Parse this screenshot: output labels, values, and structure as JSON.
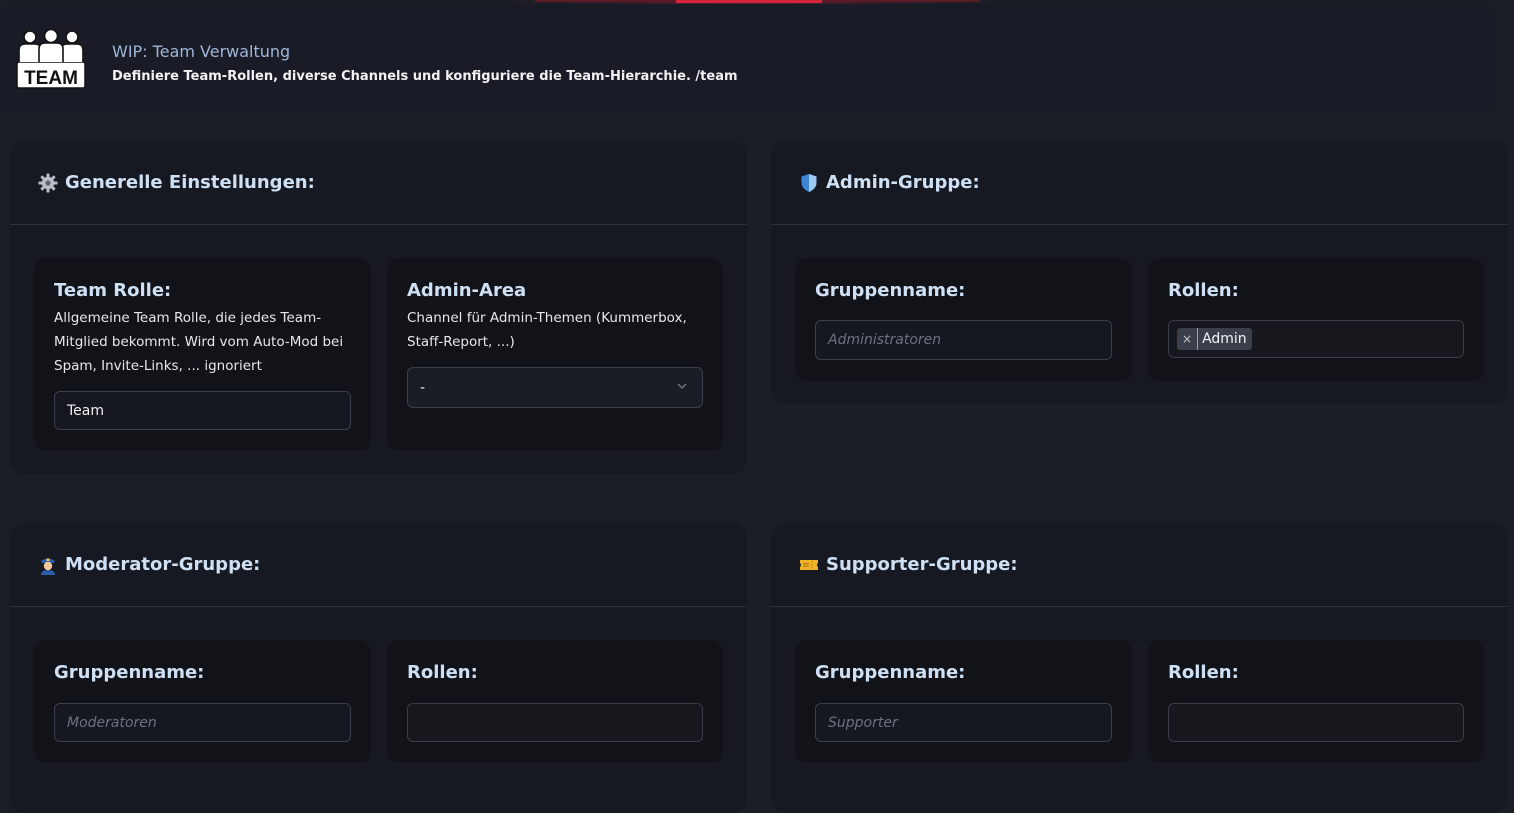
{
  "header": {
    "logo_text": "TEAM",
    "title": "WIP: Team Verwaltung",
    "description": "Definiere Team-Rollen, diverse Channels und konfiguriere die Team-Hierarchie. /team"
  },
  "general": {
    "title": "Generelle Einstellungen:",
    "icon": "gear-icon",
    "team_role": {
      "title": "Team Rolle:",
      "description": "Allgemeine Team Rolle, die jedes Team-Mitglied bekommt. Wird vom Auto-Mod bei Spam, Invite-Links, ... ignoriert",
      "value": "Team"
    },
    "admin_area": {
      "title": "Admin-Area",
      "description": "Channel für Admin-Themen (Kummerbox, Staff-Report, ...)",
      "selected": "-"
    }
  },
  "admin_group": {
    "title": "Admin-Gruppe:",
    "icon": "shield-icon",
    "group_name_label": "Gruppenname:",
    "group_name_placeholder": "Administratoren",
    "roles_label": "Rollen:",
    "roles": [
      "Admin"
    ],
    "remove_symbol": "×"
  },
  "moderator_group": {
    "title": "Moderator-Gruppe:",
    "icon": "police-officer-icon",
    "group_name_label": "Gruppenname:",
    "group_name_placeholder": "Moderatoren",
    "roles_label": "Rollen:"
  },
  "supporter_group": {
    "title": "Supporter-Gruppe:",
    "icon": "ticket-icon",
    "group_name_label": "Gruppenname:",
    "group_name_placeholder": "Supporter",
    "roles_label": "Rollen:"
  },
  "colors": {
    "background": "#1b1e27",
    "card": "#161922",
    "subcard": "#111319",
    "heading": "#cfe0f4",
    "accent_red": "#d3263c"
  }
}
